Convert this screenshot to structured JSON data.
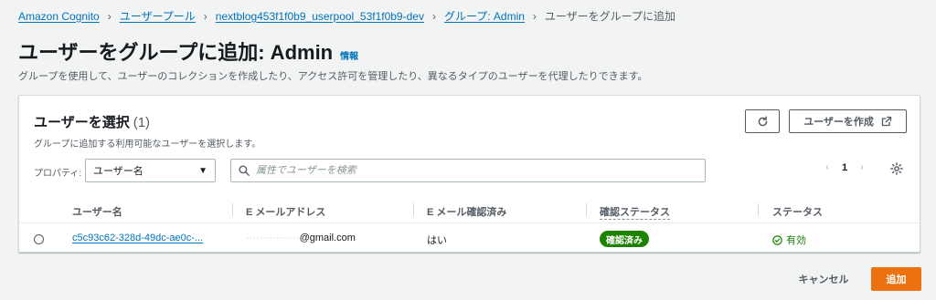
{
  "breadcrumb": {
    "items": [
      "Amazon Cognito",
      "ユーザープール",
      "nextblog453f1f0b9_userpool_53f1f0b9-dev",
      "グループ: Admin"
    ],
    "current": "ユーザーをグループに追加"
  },
  "header": {
    "title": "ユーザーをグループに追加: Admin",
    "info": "情報",
    "description": "グループを使用して、ユーザーのコレクションを作成したり、アクセス許可を管理したり、異なるタイプのユーザーを代理したりできます。"
  },
  "panel": {
    "title": "ユーザーを選択",
    "count": "(1)",
    "description": "グループに追加する利用可能なユーザーを選択します。",
    "create_button": "ユーザーを作成",
    "property_label": "プロパティ:",
    "property_value": "ユーザー名",
    "search_placeholder": "属性でユーザーを検索",
    "page_number": "1"
  },
  "table": {
    "columns": [
      "ユーザー名",
      "E メールアドレス",
      "E メール確認済み",
      "確認ステータス",
      "ステータス"
    ],
    "rows": [
      {
        "username": "c5c93c62-328d-49dc-ae0c-...",
        "email_hidden": "················",
        "email_domain": "@gmail.com",
        "email_verified": "はい",
        "confirmation": "確認済み",
        "status": "有効"
      }
    ]
  },
  "footer": {
    "cancel": "キャンセル",
    "add": "追加"
  },
  "colors": {
    "link": "#0073bb",
    "primary": "#ec7211",
    "success": "#1d8102"
  },
  "icons": [
    "chevron-right-icon",
    "refresh-icon",
    "external-link-icon",
    "caret-down-icon",
    "search-icon",
    "chevron-left-icon",
    "gear-icon",
    "check-circle-icon"
  ]
}
